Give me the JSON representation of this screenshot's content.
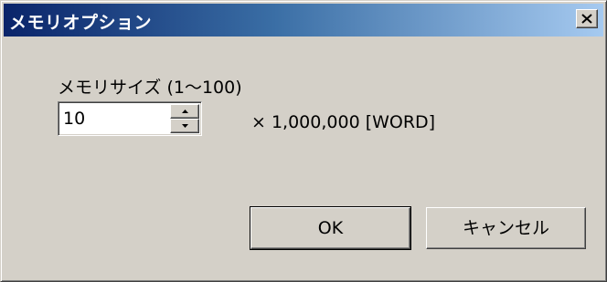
{
  "window": {
    "title": "メモリオプション",
    "close_label": "X"
  },
  "memory": {
    "label": "メモリサイズ (1〜100)",
    "value": "10",
    "multiplier": "× 1,000,000 [WORD]"
  },
  "buttons": {
    "ok": "OK",
    "cancel": "キャンセル"
  },
  "colors": {
    "face": "#d4d0c8",
    "title_start": "#0a246a",
    "title_end": "#a6caf0"
  },
  "icons": {
    "close": "close-icon",
    "spin_up": "arrow-up-icon",
    "spin_down": "arrow-down-icon"
  }
}
